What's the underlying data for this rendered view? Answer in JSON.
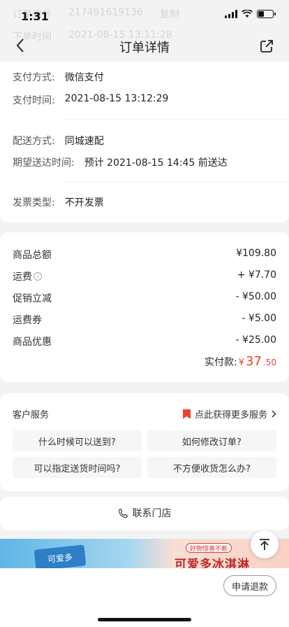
{
  "status": {
    "time": "1:31"
  },
  "ghost": {
    "order_label": "订单编号",
    "order_value": "217491619136",
    "copy": "复制",
    "time_label": "下单时间",
    "time_value": "2021-08-15 13:11:28"
  },
  "nav": {
    "title": "订单详情"
  },
  "order_info": {
    "pay_method_label": "支付方式:",
    "pay_method_value": "微信支付",
    "pay_time_label": "支付时间:",
    "pay_time_value": "2021-08-15 13:12:29",
    "delivery_method_label": "配送方式:",
    "delivery_method_value": "同城速配",
    "expected_label": "期望送达时间:",
    "expected_value": "预计 2021-08-15 14:45 前送达",
    "invoice_label": "发票类型:",
    "invoice_value": "不开发票"
  },
  "prices": {
    "subtotal_label": "商品总额",
    "subtotal_value": "¥109.80",
    "shipping_label": "运费",
    "shipping_value": "+ ¥7.70",
    "promo_label": "促销立减",
    "promo_value": "- ¥50.00",
    "ship_coupon_label": "运费券",
    "ship_coupon_value": "- ¥5.00",
    "item_discount_label": "商品优惠",
    "item_discount_value": "- ¥25.00",
    "paid_label": "实付款:",
    "paid_currency": "¥",
    "paid_int": "37",
    "paid_dec": ".50"
  },
  "service": {
    "title": "客户服务",
    "more": "点此获得更多服务",
    "faq": [
      "什么时候可以送到?",
      "如何修改订单?",
      "可以指定送货时间吗?",
      "不方便收货怎么办?"
    ],
    "contact": "联系门店"
  },
  "banner": {
    "package_text": "可爱多",
    "pill": "好物惊喜不断",
    "slogan": "可爱多冰淇淋"
  },
  "bottom": {
    "refund": "申请退款"
  },
  "colors": {
    "accent": "#e8432f",
    "page_bg": "#f3f3f3"
  }
}
